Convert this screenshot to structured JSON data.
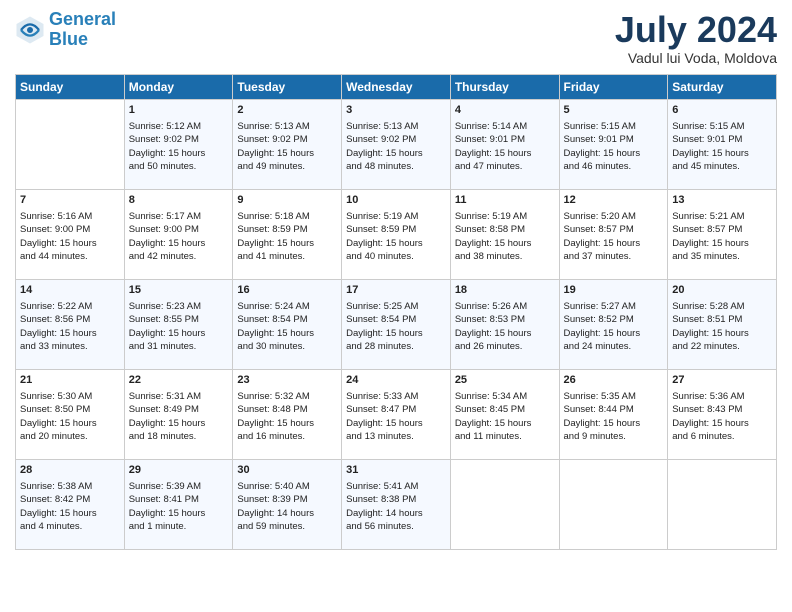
{
  "header": {
    "logo_line1": "General",
    "logo_line2": "Blue",
    "month_title": "July 2024",
    "location": "Vadul lui Voda, Moldova"
  },
  "weekdays": [
    "Sunday",
    "Monday",
    "Tuesday",
    "Wednesday",
    "Thursday",
    "Friday",
    "Saturday"
  ],
  "weeks": [
    [
      {
        "day": "",
        "content": ""
      },
      {
        "day": "1",
        "content": "Sunrise: 5:12 AM\nSunset: 9:02 PM\nDaylight: 15 hours\nand 50 minutes."
      },
      {
        "day": "2",
        "content": "Sunrise: 5:13 AM\nSunset: 9:02 PM\nDaylight: 15 hours\nand 49 minutes."
      },
      {
        "day": "3",
        "content": "Sunrise: 5:13 AM\nSunset: 9:02 PM\nDaylight: 15 hours\nand 48 minutes."
      },
      {
        "day": "4",
        "content": "Sunrise: 5:14 AM\nSunset: 9:01 PM\nDaylight: 15 hours\nand 47 minutes."
      },
      {
        "day": "5",
        "content": "Sunrise: 5:15 AM\nSunset: 9:01 PM\nDaylight: 15 hours\nand 46 minutes."
      },
      {
        "day": "6",
        "content": "Sunrise: 5:15 AM\nSunset: 9:01 PM\nDaylight: 15 hours\nand 45 minutes."
      }
    ],
    [
      {
        "day": "7",
        "content": "Sunrise: 5:16 AM\nSunset: 9:00 PM\nDaylight: 15 hours\nand 44 minutes."
      },
      {
        "day": "8",
        "content": "Sunrise: 5:17 AM\nSunset: 9:00 PM\nDaylight: 15 hours\nand 42 minutes."
      },
      {
        "day": "9",
        "content": "Sunrise: 5:18 AM\nSunset: 8:59 PM\nDaylight: 15 hours\nand 41 minutes."
      },
      {
        "day": "10",
        "content": "Sunrise: 5:19 AM\nSunset: 8:59 PM\nDaylight: 15 hours\nand 40 minutes."
      },
      {
        "day": "11",
        "content": "Sunrise: 5:19 AM\nSunset: 8:58 PM\nDaylight: 15 hours\nand 38 minutes."
      },
      {
        "day": "12",
        "content": "Sunrise: 5:20 AM\nSunset: 8:57 PM\nDaylight: 15 hours\nand 37 minutes."
      },
      {
        "day": "13",
        "content": "Sunrise: 5:21 AM\nSunset: 8:57 PM\nDaylight: 15 hours\nand 35 minutes."
      }
    ],
    [
      {
        "day": "14",
        "content": "Sunrise: 5:22 AM\nSunset: 8:56 PM\nDaylight: 15 hours\nand 33 minutes."
      },
      {
        "day": "15",
        "content": "Sunrise: 5:23 AM\nSunset: 8:55 PM\nDaylight: 15 hours\nand 31 minutes."
      },
      {
        "day": "16",
        "content": "Sunrise: 5:24 AM\nSunset: 8:54 PM\nDaylight: 15 hours\nand 30 minutes."
      },
      {
        "day": "17",
        "content": "Sunrise: 5:25 AM\nSunset: 8:54 PM\nDaylight: 15 hours\nand 28 minutes."
      },
      {
        "day": "18",
        "content": "Sunrise: 5:26 AM\nSunset: 8:53 PM\nDaylight: 15 hours\nand 26 minutes."
      },
      {
        "day": "19",
        "content": "Sunrise: 5:27 AM\nSunset: 8:52 PM\nDaylight: 15 hours\nand 24 minutes."
      },
      {
        "day": "20",
        "content": "Sunrise: 5:28 AM\nSunset: 8:51 PM\nDaylight: 15 hours\nand 22 minutes."
      }
    ],
    [
      {
        "day": "21",
        "content": "Sunrise: 5:30 AM\nSunset: 8:50 PM\nDaylight: 15 hours\nand 20 minutes."
      },
      {
        "day": "22",
        "content": "Sunrise: 5:31 AM\nSunset: 8:49 PM\nDaylight: 15 hours\nand 18 minutes."
      },
      {
        "day": "23",
        "content": "Sunrise: 5:32 AM\nSunset: 8:48 PM\nDaylight: 15 hours\nand 16 minutes."
      },
      {
        "day": "24",
        "content": "Sunrise: 5:33 AM\nSunset: 8:47 PM\nDaylight: 15 hours\nand 13 minutes."
      },
      {
        "day": "25",
        "content": "Sunrise: 5:34 AM\nSunset: 8:45 PM\nDaylight: 15 hours\nand 11 minutes."
      },
      {
        "day": "26",
        "content": "Sunrise: 5:35 AM\nSunset: 8:44 PM\nDaylight: 15 hours\nand 9 minutes."
      },
      {
        "day": "27",
        "content": "Sunrise: 5:36 AM\nSunset: 8:43 PM\nDaylight: 15 hours\nand 6 minutes."
      }
    ],
    [
      {
        "day": "28",
        "content": "Sunrise: 5:38 AM\nSunset: 8:42 PM\nDaylight: 15 hours\nand 4 minutes."
      },
      {
        "day": "29",
        "content": "Sunrise: 5:39 AM\nSunset: 8:41 PM\nDaylight: 15 hours\nand 1 minute."
      },
      {
        "day": "30",
        "content": "Sunrise: 5:40 AM\nSunset: 8:39 PM\nDaylight: 14 hours\nand 59 minutes."
      },
      {
        "day": "31",
        "content": "Sunrise: 5:41 AM\nSunset: 8:38 PM\nDaylight: 14 hours\nand 56 minutes."
      },
      {
        "day": "",
        "content": ""
      },
      {
        "day": "",
        "content": ""
      },
      {
        "day": "",
        "content": ""
      }
    ]
  ]
}
